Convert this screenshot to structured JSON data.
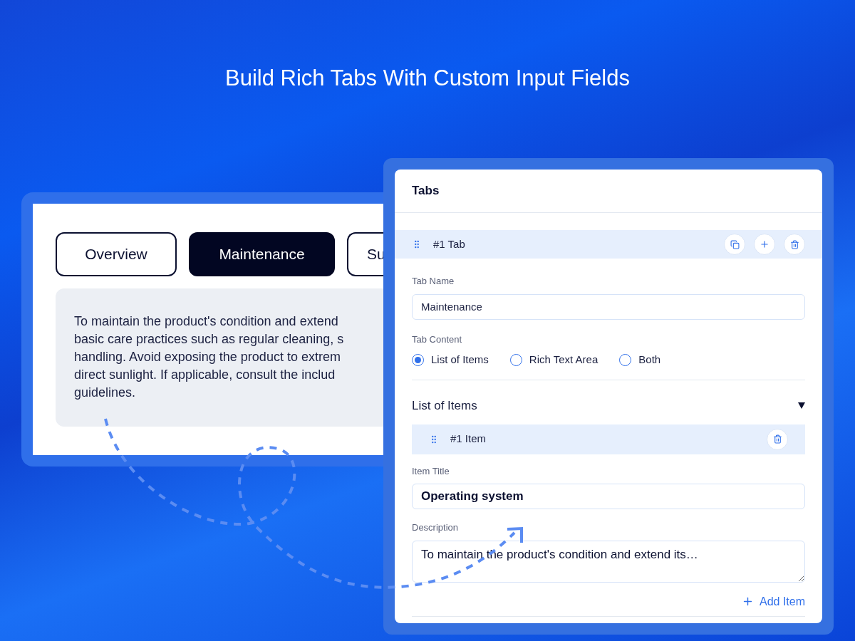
{
  "headline": "Build Rich Tabs With Custom Input Fields",
  "preview": {
    "tabs": [
      {
        "label": "Overview",
        "selected": false
      },
      {
        "label": "Maintenance",
        "selected": true
      },
      {
        "label": "Su",
        "selected": false
      }
    ],
    "content_lines": [
      "To maintain the product's condition and extend",
      "basic care practices such as regular cleaning, s",
      "handling. Avoid exposing the product to extrem",
      "direct sunlight. If applicable, consult the includ",
      "guidelines."
    ]
  },
  "panel": {
    "title": "Tabs",
    "tab_row": {
      "label": "#1 Tab"
    },
    "tab_name": {
      "label": "Tab Name",
      "value": "Maintenance"
    },
    "tab_content": {
      "label": "Tab Content",
      "options": [
        {
          "label": "List of Items",
          "selected": true
        },
        {
          "label": "Rich Text Area",
          "selected": false
        },
        {
          "label": "Both",
          "selected": false
        }
      ]
    },
    "list_section": {
      "title": "List of Items",
      "expanded": true,
      "item_row": {
        "label": "#1 Item"
      },
      "item_title": {
        "label": "Item Title",
        "value": "Operating system"
      },
      "description": {
        "label": "Description",
        "value": "To maintain the product's condition and extend its…"
      },
      "add_button": "Add Item"
    }
  }
}
